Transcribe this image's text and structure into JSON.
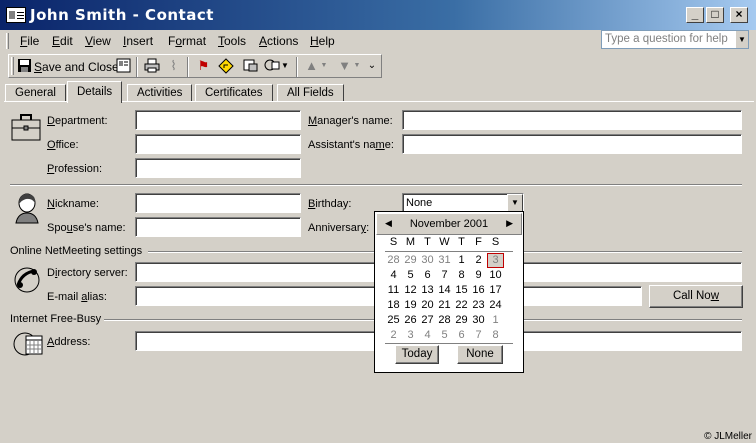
{
  "window": {
    "title": "John Smith - Contact",
    "minimize": "_",
    "maximize": "□",
    "close": "×"
  },
  "menu": {
    "items": [
      {
        "pre": "",
        "u": "F",
        "post": "ile"
      },
      {
        "pre": "",
        "u": "E",
        "post": "dit"
      },
      {
        "pre": "",
        "u": "V",
        "post": "iew"
      },
      {
        "pre": "",
        "u": "I",
        "post": "nsert"
      },
      {
        "pre": "F",
        "u": "o",
        "post": "rmat"
      },
      {
        "pre": "",
        "u": "T",
        "post": "ools"
      },
      {
        "pre": "",
        "u": "A",
        "post": "ctions"
      },
      {
        "pre": "",
        "u": "H",
        "post": "elp"
      }
    ],
    "ask_placeholder": "Type a question for help"
  },
  "toolbar": {
    "save_close_pre": "",
    "save_close_u": "S",
    "save_close_post": "ave and Close"
  },
  "tabs": [
    {
      "label": "General"
    },
    {
      "label": "Details"
    },
    {
      "label": "Activities"
    },
    {
      "label": "Certificates"
    },
    {
      "label": "All Fields"
    }
  ],
  "fields": {
    "department": {
      "pre": "",
      "u": "D",
      "post": "epartment:"
    },
    "office": {
      "pre": "",
      "u": "O",
      "post": "ffice:"
    },
    "profession": {
      "pre": "",
      "u": "P",
      "post": "rofession:"
    },
    "managers_name": {
      "pre": "",
      "u": "M",
      "post": "anager's name:"
    },
    "assistants_name": {
      "pre": "Assistant's na",
      "u": "m",
      "post": "e:"
    },
    "nickname": {
      "pre": "",
      "u": "N",
      "post": "ickname:"
    },
    "spouses_name": {
      "pre": "Spo",
      "u": "u",
      "post": "se's name:"
    },
    "birthday": {
      "pre": "",
      "u": "B",
      "post": "irthday:"
    },
    "birthday_value": "None",
    "anniversary": {
      "pre": "Anniversar",
      "u": "y",
      "post": ":"
    },
    "directory_server": {
      "pre": "D",
      "u": "i",
      "post": "rectory server:"
    },
    "email_alias": {
      "pre": "E-mail ",
      "u": "a",
      "post": "lias:"
    },
    "address": {
      "pre": "",
      "u": "A",
      "post": "ddress:"
    }
  },
  "groups": {
    "netmeeting": "Online NetMeeting settings",
    "freebusy": "Internet Free-Busy"
  },
  "buttons": {
    "call_now_pre": "Call No",
    "call_now_u": "w",
    "call_now_post": ""
  },
  "calendar": {
    "month_label": "November 2001",
    "dow": [
      "S",
      "M",
      "T",
      "W",
      "T",
      "F",
      "S"
    ],
    "weeks": [
      [
        "28",
        "29",
        "30",
        "31",
        "1",
        "2",
        "3"
      ],
      [
        "4",
        "5",
        "6",
        "7",
        "8",
        "9",
        "10"
      ],
      [
        "11",
        "12",
        "13",
        "14",
        "15",
        "16",
        "17"
      ],
      [
        "18",
        "19",
        "20",
        "21",
        "22",
        "23",
        "24"
      ],
      [
        "25",
        "26",
        "27",
        "28",
        "29",
        "30",
        "1"
      ],
      [
        "2",
        "3",
        "4",
        "5",
        "6",
        "7",
        "8"
      ]
    ],
    "today_label": "Today",
    "none_label": "None"
  },
  "watermark": "© JLMeller"
}
